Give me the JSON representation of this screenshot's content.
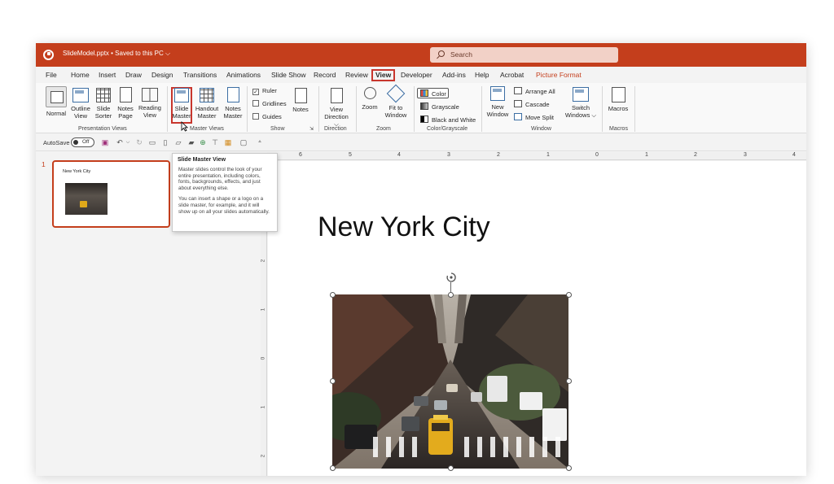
{
  "titlebar": {
    "doc_title": "SlideModel.pptx • Saved to this PC ⌵",
    "search_placeholder": "Search",
    "accent_color": "#c43e1c"
  },
  "tabs": [
    "File",
    "Home",
    "Insert",
    "Draw",
    "Design",
    "Transitions",
    "Animations",
    "Slide Show",
    "Record",
    "Review",
    "View",
    "Developer",
    "Add-ins",
    "Help",
    "Acrobat",
    "Picture Format"
  ],
  "active_tab": "View",
  "ribbon": {
    "presentation_views": {
      "label": "Presentation Views",
      "normal": "Normal",
      "outline": [
        "Outline",
        "View"
      ],
      "sorter": [
        "Slide",
        "Sorter"
      ],
      "notes_page": [
        "Notes",
        "Page"
      ],
      "reading": [
        "Reading",
        "View"
      ]
    },
    "master_views": {
      "label": "Master Views",
      "slide_master": [
        "Slide",
        "Master"
      ],
      "handout_master": [
        "Handout",
        "Master"
      ],
      "notes_master": [
        "Notes",
        "Master"
      ]
    },
    "show": {
      "label": "Show",
      "ruler": "Ruler",
      "gridlines": "Gridlines",
      "guides": "Guides",
      "notes": "Notes"
    },
    "direction": {
      "label": "Direction",
      "view_direction": [
        "View",
        "Direction ⌵"
      ]
    },
    "zoom": {
      "label": "Zoom",
      "zoom": "Zoom",
      "fit": [
        "Fit to",
        "Window"
      ]
    },
    "color": {
      "label": "Color/Grayscale",
      "color": "Color",
      "grayscale": "Grayscale",
      "bw": "Black and White"
    },
    "window": {
      "label": "Window",
      "new_window": [
        "New",
        "Window"
      ],
      "arrange_all": "Arrange All",
      "cascade": "Cascade",
      "move_split": "Move Split",
      "switch": [
        "Switch",
        "Windows ⌵"
      ]
    },
    "macros": {
      "label": "Macros",
      "macros": "Macros"
    }
  },
  "qat": {
    "autosave_label": "AutoSave",
    "toggle_state": "Off"
  },
  "ruler": {
    "h_numbers": [
      "6",
      "5",
      "4",
      "3",
      "2",
      "1",
      "0",
      "1",
      "2",
      "3",
      "4"
    ],
    "v_numbers": [
      "2",
      "1",
      "0",
      "1",
      "2"
    ]
  },
  "thumbnails": [
    {
      "number": "1",
      "title": "New York City"
    }
  ],
  "tooltip": {
    "title": "Slide Master View",
    "p1": "Master slides control the look of your entire presentation, including colors, fonts, backgrounds, effects, and just about everything else.",
    "p2": "You can insert a shape or a logo on a slide master, for example, and it will show up on all your slides automatically."
  },
  "slide": {
    "title": "New York City"
  }
}
